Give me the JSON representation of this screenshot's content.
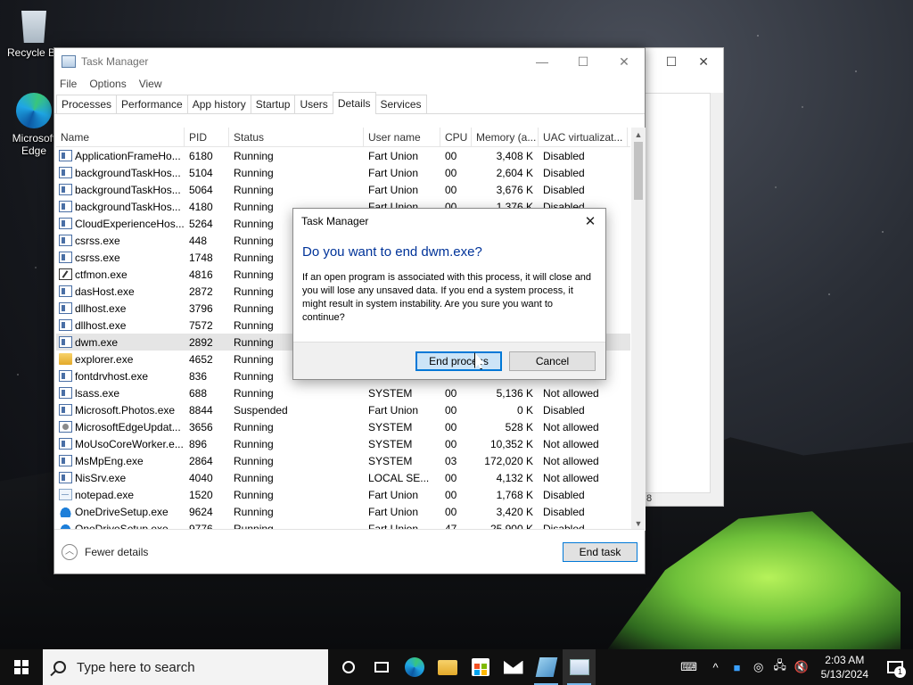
{
  "desktop": {
    "icons": [
      {
        "label": "Recycle Bin"
      },
      {
        "label": "Microsoft Edge"
      }
    ]
  },
  "background_window": {
    "frag_text": "8"
  },
  "task_manager": {
    "title": "Task Manager",
    "menu": [
      "File",
      "Options",
      "View"
    ],
    "tabs": [
      "Processes",
      "Performance",
      "App history",
      "Startup",
      "Users",
      "Details",
      "Services"
    ],
    "active_tab": "Details",
    "columns": {
      "name": "Name",
      "pid": "PID",
      "status": "Status",
      "user": "User name",
      "cpu": "CPU",
      "mem": "Memory (a...",
      "uac": "UAC virtualizat..."
    },
    "rows": [
      {
        "name": "ApplicationFrameHo...",
        "pid": "6180",
        "status": "Running",
        "user": "Fart Union",
        "cpu": "00",
        "mem": "3,408 K",
        "uac": "Disabled",
        "icon": "app-window-icon"
      },
      {
        "name": "backgroundTaskHos...",
        "pid": "5104",
        "status": "Running",
        "user": "Fart Union",
        "cpu": "00",
        "mem": "2,604 K",
        "uac": "Disabled",
        "icon": "app-window-icon"
      },
      {
        "name": "backgroundTaskHos...",
        "pid": "5064",
        "status": "Running",
        "user": "Fart Union",
        "cpu": "00",
        "mem": "3,676 K",
        "uac": "Disabled",
        "icon": "app-window-icon"
      },
      {
        "name": "backgroundTaskHos...",
        "pid": "4180",
        "status": "Running",
        "user": "Fart Union",
        "cpu": "00",
        "mem": "1,376 K",
        "uac": "Disabled",
        "icon": "app-window-icon"
      },
      {
        "name": "CloudExperienceHos...",
        "pid": "5264",
        "status": "Running",
        "user": "",
        "cpu": "",
        "mem": "",
        "uac": "",
        "icon": "app-window-icon"
      },
      {
        "name": "csrss.exe",
        "pid": "448",
        "status": "Running",
        "user": "",
        "cpu": "",
        "mem": "",
        "uac": "",
        "icon": "app-window-icon"
      },
      {
        "name": "csrss.exe",
        "pid": "1748",
        "status": "Running",
        "user": "",
        "cpu": "",
        "mem": "",
        "uac": "",
        "icon": "app-window-icon"
      },
      {
        "name": "ctfmon.exe",
        "pid": "4816",
        "status": "Running",
        "user": "",
        "cpu": "",
        "mem": "",
        "uac": "",
        "icon": "pen-icon"
      },
      {
        "name": "dasHost.exe",
        "pid": "2872",
        "status": "Running",
        "user": "",
        "cpu": "",
        "mem": "",
        "uac": "",
        "icon": "app-window-icon"
      },
      {
        "name": "dllhost.exe",
        "pid": "3796",
        "status": "Running",
        "user": "",
        "cpu": "",
        "mem": "",
        "uac": "",
        "icon": "app-window-icon"
      },
      {
        "name": "dllhost.exe",
        "pid": "7572",
        "status": "Running",
        "user": "",
        "cpu": "",
        "mem": "",
        "uac": "",
        "icon": "app-window-icon"
      },
      {
        "name": "dwm.exe",
        "pid": "2892",
        "status": "Running",
        "user": "",
        "cpu": "",
        "mem": "",
        "uac": "",
        "icon": "app-window-icon",
        "selected": true
      },
      {
        "name": "explorer.exe",
        "pid": "4652",
        "status": "Running",
        "user": "",
        "cpu": "",
        "mem": "",
        "uac": "",
        "icon": "folder-icon"
      },
      {
        "name": "fontdrvhost.exe",
        "pid": "836",
        "status": "Running",
        "user": "",
        "cpu": "",
        "mem": "",
        "uac": "",
        "icon": "app-window-icon"
      },
      {
        "name": "lsass.exe",
        "pid": "688",
        "status": "Running",
        "user": "SYSTEM",
        "cpu": "00",
        "mem": "5,136 K",
        "uac": "Not allowed",
        "icon": "app-window-icon"
      },
      {
        "name": "Microsoft.Photos.exe",
        "pid": "8844",
        "status": "Suspended",
        "user": "Fart Union",
        "cpu": "00",
        "mem": "0 K",
        "uac": "Disabled",
        "icon": "app-window-icon"
      },
      {
        "name": "MicrosoftEdgeUpdat...",
        "pid": "3656",
        "status": "Running",
        "user": "SYSTEM",
        "cpu": "00",
        "mem": "528 K",
        "uac": "Not allowed",
        "icon": "gear-icon"
      },
      {
        "name": "MoUsoCoreWorker.e...",
        "pid": "896",
        "status": "Running",
        "user": "SYSTEM",
        "cpu": "00",
        "mem": "10,352 K",
        "uac": "Not allowed",
        "icon": "app-window-icon"
      },
      {
        "name": "MsMpEng.exe",
        "pid": "2864",
        "status": "Running",
        "user": "SYSTEM",
        "cpu": "03",
        "mem": "172,020 K",
        "uac": "Not allowed",
        "icon": "app-window-icon"
      },
      {
        "name": "NisSrv.exe",
        "pid": "4040",
        "status": "Running",
        "user": "LOCAL SE...",
        "cpu": "00",
        "mem": "4,132 K",
        "uac": "Not allowed",
        "icon": "app-window-icon"
      },
      {
        "name": "notepad.exe",
        "pid": "1520",
        "status": "Running",
        "user": "Fart Union",
        "cpu": "00",
        "mem": "1,768 K",
        "uac": "Disabled",
        "icon": "notepad-icon"
      },
      {
        "name": "OneDriveSetup.exe",
        "pid": "9624",
        "status": "Running",
        "user": "Fart Union",
        "cpu": "00",
        "mem": "3,420 K",
        "uac": "Disabled",
        "icon": "cloud-icon"
      },
      {
        "name": "OneDriveSetup.exe",
        "pid": "9776",
        "status": "Running",
        "user": "Fart Union",
        "cpu": "47",
        "mem": "25,900 K",
        "uac": "Disabled",
        "icon": "cloud-icon"
      }
    ],
    "footer": {
      "fewer_details": "Fewer details",
      "end_task": "End task"
    }
  },
  "dialog": {
    "title": "Task Manager",
    "question": "Do you want to end dwm.exe?",
    "message": "If an open program is associated with this process, it will close and you will lose any unsaved data. If you end a system process, it might result in system instability. Are you sure you want to continue?",
    "primary": "End process",
    "secondary": "Cancel"
  },
  "taskbar": {
    "search_placeholder": "Type here to search",
    "time": "2:03 AM",
    "date": "5/13/2024",
    "notification_count": "1"
  }
}
